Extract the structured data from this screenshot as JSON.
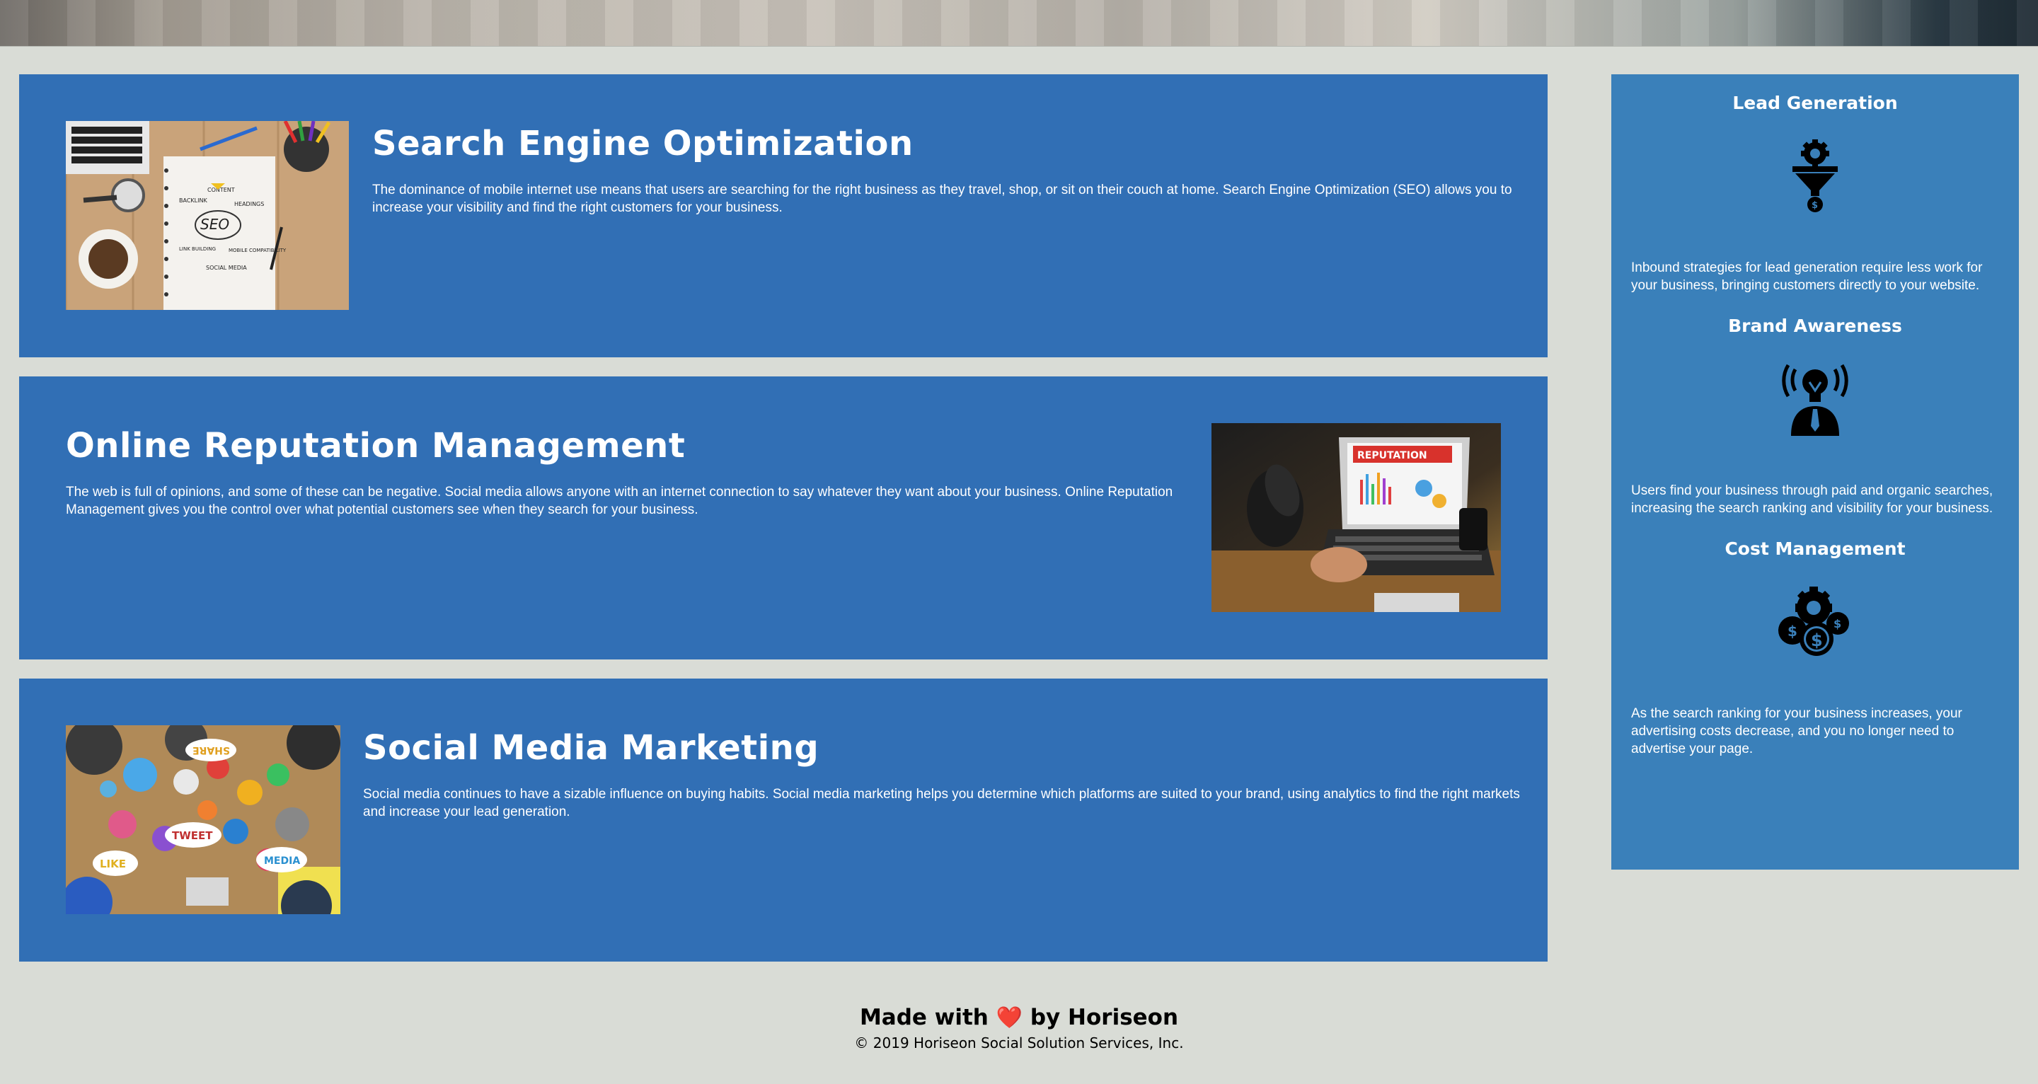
{
  "services": [
    {
      "title": "Search Engine Optimization",
      "body": "The dominance of mobile internet use means that users are searching for the right business as they travel, shop, or sit on their couch at home. Search Engine Optimization (SEO) allows you to increase your visibility and find the right customers for your business.",
      "image_words": [
        "CONTENT",
        "BACKLINK",
        "HEADINGS",
        "SEO",
        "LINK BUILDING",
        "MOBILE COMPATIBILITY",
        "SOCIAL MEDIA"
      ]
    },
    {
      "title": "Online Reputation Management",
      "body": "The web is full of opinions, and some of these can be negative. Social media allows anyone with an internet connection to say whatever they want about your business. Online Reputation Management gives you the control over what potential customers see when they search for your business.",
      "image_words": [
        "REPUTATION"
      ]
    },
    {
      "title": "Social Media Marketing",
      "body": "Social media continues to have a sizable influence on buying habits. Social media marketing helps you determine which platforms are suited to your brand, using analytics to find the right markets and increase your lead generation.",
      "image_words": [
        "SHARE",
        "TWEET",
        "LIKE",
        "MEDIA"
      ]
    }
  ],
  "benefits": [
    {
      "title": "Lead Generation",
      "icon": "lead-funnel-icon",
      "body": "Inbound strategies for lead generation require less work for your business, bringing customers directly to your website."
    },
    {
      "title": "Brand Awareness",
      "icon": "lightbulb-person-icon",
      "body": "Users find your business through paid and organic searches, increasing the search ranking and visibility for your business."
    },
    {
      "title": "Cost Management",
      "icon": "gears-dollar-icon",
      "body": "As the search ranking for your business increases, your advertising costs decrease, and you no longer need to advertise your page."
    }
  ],
  "footer": {
    "made_prefix": "Made with",
    "heart": "❤️",
    "made_suffix": "by Horiseon",
    "copyright": "© 2019 Horiseon Social Solution Services, Inc."
  },
  "colors": {
    "page_bg": "#d9dcd6",
    "card_bg": "#316fb5",
    "sidebar_bg": "#3a80ba",
    "text_light": "#ffffff"
  }
}
